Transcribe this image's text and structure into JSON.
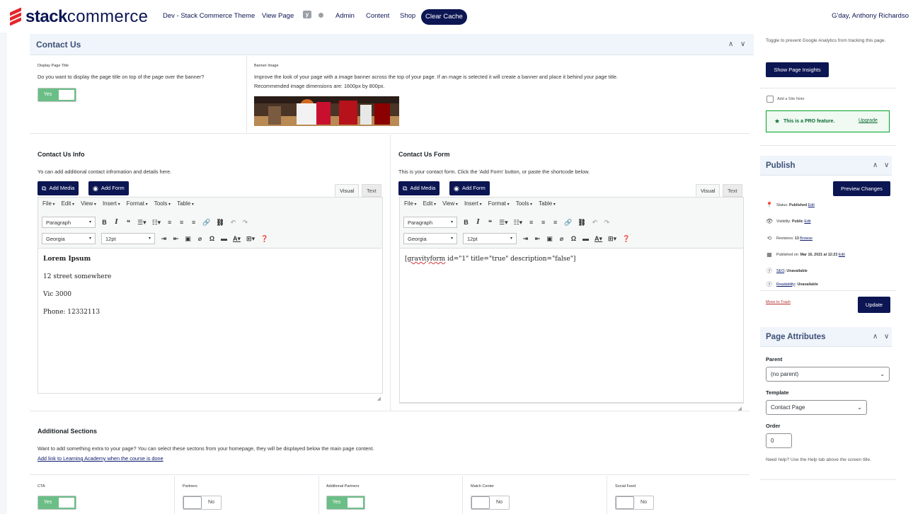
{
  "topbar": {
    "logo_bold": "stack",
    "logo_light": "commerce",
    "nav": [
      "Dev - Stack Commerce Theme",
      "View Page",
      "Admin",
      "Content",
      "Shop"
    ],
    "clear_cache": "Clear Cache",
    "greeting": "G'day, Anthony Richardso"
  },
  "contact_panel": {
    "title": "Contact Us",
    "display_title_label": "Display Page Title",
    "display_title_desc": "Do you want to display the page title on top of the page over the banner?",
    "display_title_toggle": "Yes",
    "banner_label": "Banner Image",
    "banner_desc_1": "Improve the look of your page with a image banner across the top of your page. If an mage is selected it will create a banner and place it behind your page title.",
    "banner_desc_2": "Recommended image dimensions are: 1600px by 800px."
  },
  "editor_left": {
    "heading": "Contact Us Info",
    "desc": "Yo can add additional contact infromation and details here.",
    "add_media": "Add Media",
    "add_form": "Add Form",
    "tab_visual": "Visual",
    "tab_text": "Text",
    "lines": [
      "Lorem Ipsum",
      "12 street somewhere",
      "Vic 3000",
      "Phone: 12332113"
    ]
  },
  "editor_right": {
    "heading": "Contact Us Form",
    "desc": "This is your contact form. Click the 'Add Form' button, or paste the shortcode below.",
    "add_media": "Add Media",
    "add_form": "Add Form",
    "tab_visual": "Visual",
    "tab_text": "Text",
    "shortcode_tag": "gravityform",
    "shortcode_rest": " id=\"1\" title=\"true\" description=\"false\"]"
  },
  "editor_common": {
    "menu": [
      "File",
      "Edit",
      "View",
      "Insert",
      "Format",
      "Tools",
      "Table"
    ],
    "format_select": "Paragraph",
    "font_select": "Georgia",
    "size_select": "12pt"
  },
  "additional": {
    "heading": "Additional Sections",
    "desc": "Want to add something extra to your page? You can select these sectons from your homepage, they will be displayed below the main page content.",
    "link": "Add link to Learning Academy when the course is done",
    "toggles": [
      {
        "label": "CTA",
        "state": "Yes"
      },
      {
        "label": "Partners",
        "state": "No"
      },
      {
        "label": "Additional Partners",
        "state": "Yes"
      },
      {
        "label": "Match Center",
        "state": "No"
      },
      {
        "label": "Social Feed",
        "state": "No"
      }
    ]
  },
  "sidebar": {
    "analytics_text": "Toggle to prevent Google Analytics from tracking this page.",
    "insights_button": "Show Page Insights",
    "site_note": "Add a Site Note",
    "pro_text": "This is a PRO feature.",
    "upgrade": "Upgrade",
    "publish": {
      "title": "Publish",
      "preview": "Preview Changes",
      "status_label": "Status: ",
      "status_value": "Published",
      "visibility_label": "Visibility: ",
      "visibility_value": "Public",
      "revisions_label": "Revisions: ",
      "revisions_value": "13",
      "browse": "Browse",
      "edit": "Edit",
      "published_on_label": "Published on: ",
      "published_on_value": "Mar 16, 2021 at 12:23",
      "seo": "SEO",
      "seo_value": ": Unavailable",
      "readability": "Readability",
      "readability_value": ": Unavailable",
      "trash": "Move to Trash",
      "update": "Update"
    },
    "attributes": {
      "title": "Page Attributes",
      "parent_label": "Parent",
      "parent_value": "(no parent)",
      "template_label": "Template",
      "template_value": "Contact Page",
      "order_label": "Order",
      "order_value": "0",
      "help": "Need help? Use the Help tab above the screen title."
    }
  }
}
